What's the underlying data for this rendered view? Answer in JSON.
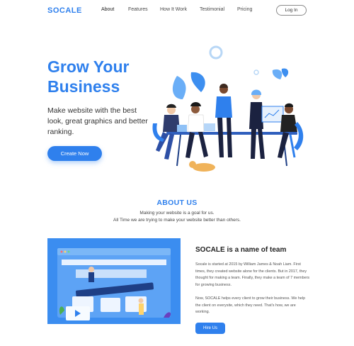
{
  "nav": {
    "logo": "SOCALE",
    "links": [
      "About",
      "Features",
      "How It Work",
      "Testimonial",
      "Pricing"
    ],
    "login_label": "Log In"
  },
  "hero": {
    "title_line1": "Grow Your",
    "title_line2": "Business",
    "subtitle": "Make website with the best look, great graphics and better ranking.",
    "cta_label": "Create Now"
  },
  "about": {
    "title": "ABOUT US",
    "line1": "Making your website is a goal for us.",
    "line2": "All Time we are trying to make your website better than others."
  },
  "team": {
    "title": "SOCALE is a name of team",
    "p1": "Socale is started at 2015 by William James & Noah Liam. First times, they created website alone for the clients. But in 2017, they thought for making a team. Finally, they make a team of 7 members for growing business.",
    "p2": "Now, SOCALE helps every client to grow their business. We help the client on everysite, which they need. That's how, we are working.",
    "hire_label": "Hire Us"
  },
  "colors": {
    "accent": "#2f80ed",
    "dark": "#2b2b2b"
  }
}
